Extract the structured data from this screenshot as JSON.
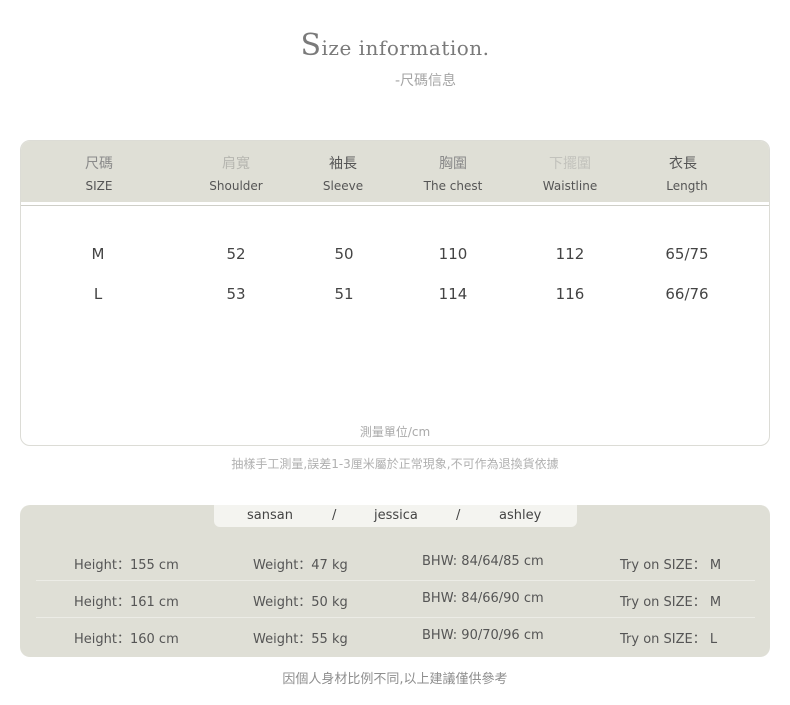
{
  "title": {
    "first_letter": "S",
    "rest": "ize information."
  },
  "subtitle": "-尺碼信息",
  "size_table": {
    "headers": [
      {
        "zh": "尺碼",
        "en": "SIZE"
      },
      {
        "zh": "肩寬",
        "en": "Shoulder"
      },
      {
        "zh": "袖長",
        "en": "Sleeve"
      },
      {
        "zh": "胸圍",
        "en": "The chest"
      },
      {
        "zh": "下擺圍",
        "en": "Waistline"
      },
      {
        "zh": "衣長",
        "en": "Length"
      }
    ],
    "rows": [
      [
        "M",
        "52",
        "50",
        "110",
        "112",
        "65/75"
      ],
      [
        "L",
        "53",
        "51",
        "114",
        "116",
        "66/76"
      ]
    ],
    "unit_note": "測量單位/cm"
  },
  "measure_note": "抽樣手工測量,誤差1-3厘米屬於正常現象,不可作為退換貨依據",
  "models": {
    "names": [
      "sansan",
      "jessica",
      "ashley"
    ],
    "separator": "/",
    "rows": [
      {
        "height": "Height：155 cm",
        "weight": "Weight：47 kg",
        "bhw": "BHW: 84/64/85 cm",
        "size": "Try on SIZE：  M"
      },
      {
        "height": "Height：161 cm",
        "weight": "Weight：50 kg",
        "bhw": "BHW: 84/66/90 cm",
        "size": "Try on SIZE：  M"
      },
      {
        "height": "Height：160 cm",
        "weight": "Weight：55 kg",
        "bhw": "BHW: 90/70/96 cm",
        "size": "Try on SIZE：  L"
      }
    ]
  },
  "footer_note": "因個人身材比例不同,以上建議僅供參考"
}
